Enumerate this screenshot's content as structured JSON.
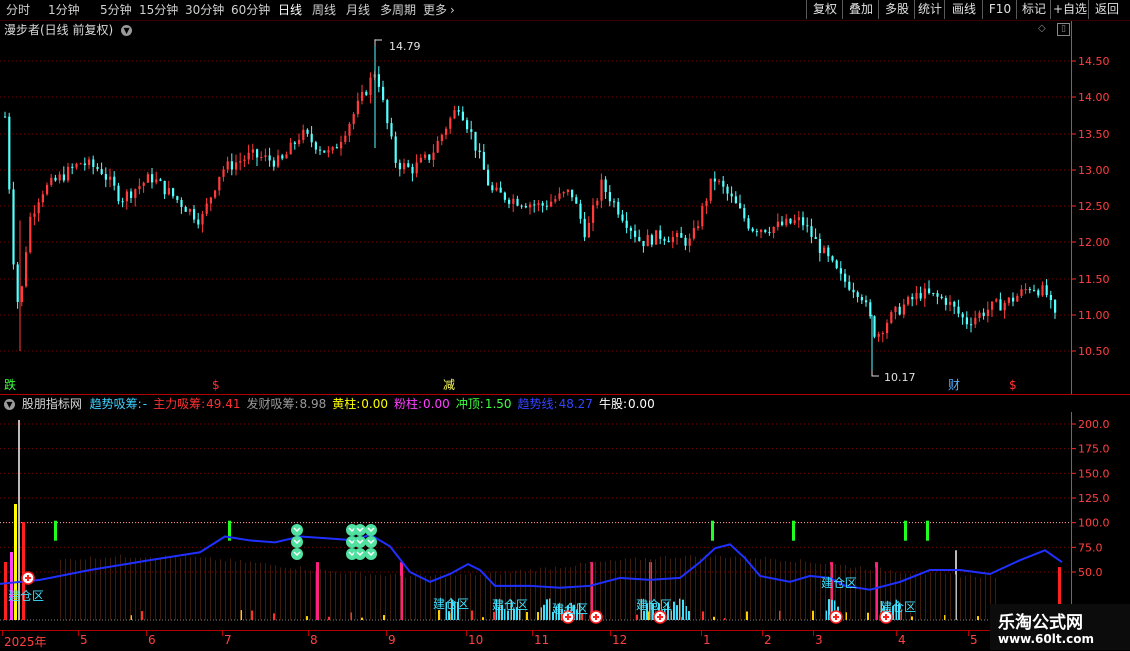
{
  "toolbar": {
    "periods": [
      "分时",
      "1分钟",
      "5分钟",
      "15分钟",
      "30分钟",
      "60分钟",
      "日线",
      "周线",
      "月线",
      "多周期",
      "更多"
    ],
    "more_arrow": "›",
    "right_buttons": [
      "复权",
      "叠加",
      "多股",
      "统计",
      "画线",
      "F10",
      "标记",
      "+自选",
      "返回"
    ]
  },
  "main_chart": {
    "title": "漫步者(日线 前复权)",
    "y_ticks": [
      "14.50",
      "14.00",
      "13.50",
      "13.00",
      "12.50",
      "12.00",
      "11.50",
      "11.00",
      "10.50"
    ],
    "high_label": "14.79",
    "low_label": "10.17",
    "markers": [
      "跌",
      "$",
      "减",
      "财",
      "$"
    ],
    "colors": {
      "up": "#ff3b3b",
      "down": "#54ffff",
      "grid": "#7a0000",
      "axis": "#ff2a2a"
    }
  },
  "indicator": {
    "name": "股朋指标网",
    "params": [
      {
        "label": "趋势吸筹:",
        "value": "-",
        "color": "#3fd0ff"
      },
      {
        "label": "主力吸筹:",
        "value": "49.41",
        "color": "#ff3030"
      },
      {
        "label": "发财吸筹:",
        "value": "8.98",
        "color": "#9a9a9a"
      },
      {
        "label": "黄柱:",
        "value": "0.00",
        "color": "#ffff00"
      },
      {
        "label": "粉柱:",
        "value": "0.00",
        "color": "#ff40ff"
      },
      {
        "label": "冲顶:",
        "value": "1.50",
        "color": "#40ff40"
      },
      {
        "label": "趋势线:",
        "value": "48.27",
        "color": "#3344ff"
      },
      {
        "label": "牛股:",
        "value": "0.00",
        "color": "#ffffff"
      }
    ],
    "y_ticks": [
      "200.0",
      "175.0",
      "150.0",
      "125.0",
      "100.0",
      "75.0",
      "50.0"
    ],
    "zone_labels": [
      "建仓区",
      "建仓区",
      "建仓区",
      "建仓区",
      "建仓区",
      "建仓区",
      "建仓区"
    ]
  },
  "time_axis": {
    "labels": [
      "2025年",
      "5",
      "6",
      "7",
      "8",
      "9",
      "10",
      "11",
      "12",
      "1",
      "2",
      "3",
      "4",
      "5"
    ]
  },
  "watermark": {
    "title": "乐淘公式网",
    "url": "www.60lt.com"
  }
}
